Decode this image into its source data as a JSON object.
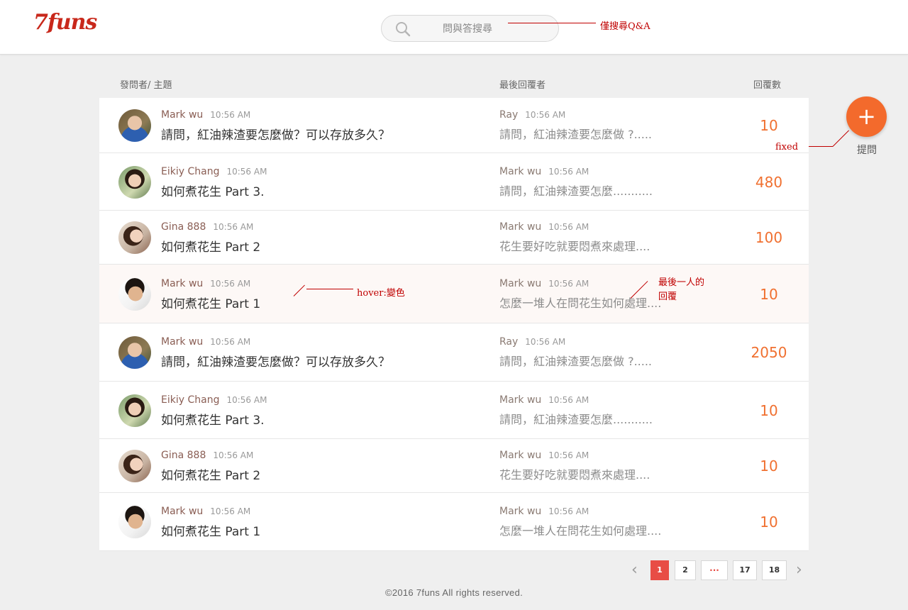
{
  "header": {
    "logo": "7funs",
    "search_placeholder": "問與答搜尋"
  },
  "annotations": {
    "search_note": "僅搜尋Q&A",
    "fab_note": "fixed",
    "hover_note": "hover:變色",
    "last_reply_note_line1": "最後一人的",
    "last_reply_note_line2": "回覆"
  },
  "columns": {
    "topic": "發問者/ 主題",
    "last_replier": "最後回覆者",
    "replies": "回覆數"
  },
  "rows": [
    {
      "author": "Mark wu",
      "time": "10:56 AM",
      "title": "請問，紅油辣渣要怎麼做？可以存放多久？",
      "replier": "Ray",
      "reply_time": "10:56 AM",
      "reply": "請問，紅油辣渣要怎麼做 ?.....",
      "count": "10",
      "avatar": "avatar-woman-outdoor"
    },
    {
      "author": "Eikiy Chang",
      "time": "10:56 AM",
      "title": "如何煮花生 Part 3.",
      "replier": "Mark wu",
      "reply_time": "10:56 AM",
      "reply": "請問，紅油辣渣要怎麼...........",
      "count": "480",
      "avatar": "avatar-woman-leaves"
    },
    {
      "author": "Gina 888",
      "time": "10:56 AM",
      "title": "如何煮花生 Part 2",
      "replier": "Mark wu",
      "reply_time": "10:56 AM",
      "reply": "花生要好吃就要悶煮來處理....",
      "count": "100",
      "avatar": "avatar-woman-drink"
    },
    {
      "author": "Mark wu",
      "time": "10:56 AM",
      "title": "如何煮花生 Part 1",
      "replier": "Mark wu",
      "reply_time": "10:56 AM",
      "reply": "怎麼一堆人在問花生如何處理....",
      "count": "10",
      "avatar": "avatar-man"
    },
    {
      "author": "Mark wu",
      "time": "10:56 AM",
      "title": "請問，紅油辣渣要怎麼做？可以存放多久？",
      "replier": "Ray",
      "reply_time": "10:56 AM",
      "reply": "請問，紅油辣渣要怎麼做 ?.....",
      "count": "2050",
      "avatar": "avatar-woman-outdoor"
    },
    {
      "author": "Eikiy Chang",
      "time": "10:56 AM",
      "title": "如何煮花生 Part 3.",
      "replier": "Mark wu",
      "reply_time": "10:56 AM",
      "reply": "請問，紅油辣渣要怎麼...........",
      "count": "10",
      "avatar": "avatar-woman-leaves"
    },
    {
      "author": "Gina 888",
      "time": "10:56 AM",
      "title": "如何煮花生 Part 2",
      "replier": "Mark wu",
      "reply_time": "10:56 AM",
      "reply": "花生要好吃就要悶煮來處理....",
      "count": "10",
      "avatar": "avatar-woman-drink"
    },
    {
      "author": "Mark wu",
      "time": "10:56 AM",
      "title": "如何煮花生 Part 1",
      "replier": "Mark wu",
      "reply_time": "10:56 AM",
      "reply": "怎麼一堆人在問花生如何處理....",
      "count": "10",
      "avatar": "avatar-man"
    }
  ],
  "fab": {
    "icon": "plus-icon",
    "symbol": "+",
    "label": "提問"
  },
  "pagination": {
    "pages": [
      "1",
      "2",
      "···",
      "17",
      "18"
    ],
    "current": "1",
    "prev_symbol": "‹",
    "next_symbol": "›"
  },
  "footer": "©2016 7funs All rights reserved.",
  "colors": {
    "brand": "#c8281b",
    "accent": "#f36a2c",
    "count": "#f07030",
    "page_active": "#e84d45",
    "annotation": "#c00000",
    "hover_row": "#fdf8f6"
  }
}
